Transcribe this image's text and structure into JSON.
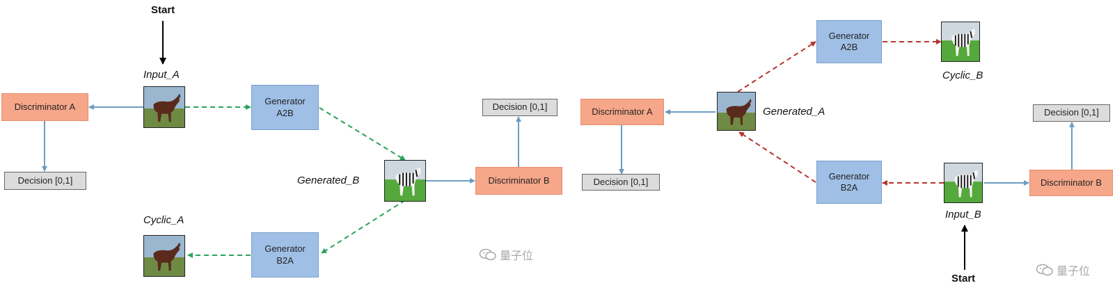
{
  "start_label": "Start",
  "left": {
    "input_a": "Input_A",
    "generator_a2b": "Generator\nA2B",
    "generator_b2a": "Generator\nB2A",
    "discriminator_a": "Discriminator A",
    "discriminator_b": "Discriminator B",
    "decision_a": "Decision [0,1]",
    "decision_b": "Decision [0,1]",
    "generated_b": "Generated_B",
    "cyclic_a": "Cyclic_A",
    "watermark": "量子位"
  },
  "right": {
    "generator_a2b": "Generator\nA2B",
    "generator_b2a": "Generator\nB2A",
    "discriminator_a": "Discriminator A",
    "discriminator_b": "Discriminator B",
    "decision_a": "Decision [0,1]",
    "decision_b": "Decision [0,1]",
    "generated_a": "Generated_A",
    "cyclic_b": "Cyclic_B",
    "input_b": "Input_B",
    "watermark": "量子位"
  },
  "colors": {
    "forward_arrow": "#2aa35a",
    "backward_arrow": "#b5332f",
    "connector": "#6c9cc2",
    "start_arrow": "#000000"
  },
  "icons": [
    "horse-image",
    "zebra-image",
    "wechat-icon"
  ]
}
